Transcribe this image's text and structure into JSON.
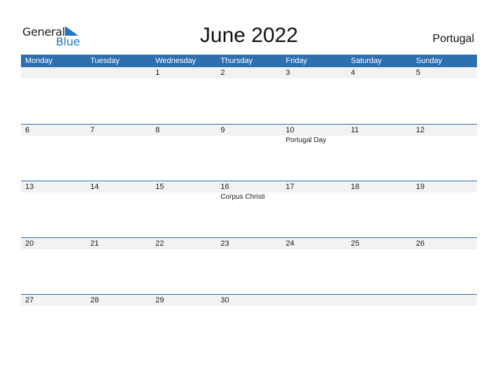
{
  "logo": {
    "word1": "General",
    "word2": "Blue"
  },
  "title": "June 2022",
  "country": "Portugal",
  "colors": {
    "header_bg": "#2e6fb0",
    "date_strip_bg": "#f2f2f2",
    "logo_blue": "#1e78c8"
  },
  "weekdays": [
    "Monday",
    "Tuesday",
    "Wednesday",
    "Thursday",
    "Friday",
    "Saturday",
    "Sunday"
  ],
  "weeks": [
    {
      "days": [
        {
          "num": "",
          "event": ""
        },
        {
          "num": "",
          "event": ""
        },
        {
          "num": "1",
          "event": ""
        },
        {
          "num": "2",
          "event": ""
        },
        {
          "num": "3",
          "event": ""
        },
        {
          "num": "4",
          "event": ""
        },
        {
          "num": "5",
          "event": ""
        }
      ]
    },
    {
      "days": [
        {
          "num": "6",
          "event": ""
        },
        {
          "num": "7",
          "event": ""
        },
        {
          "num": "8",
          "event": ""
        },
        {
          "num": "9",
          "event": ""
        },
        {
          "num": "10",
          "event": "Portugal Day"
        },
        {
          "num": "11",
          "event": ""
        },
        {
          "num": "12",
          "event": ""
        }
      ]
    },
    {
      "days": [
        {
          "num": "13",
          "event": ""
        },
        {
          "num": "14",
          "event": ""
        },
        {
          "num": "15",
          "event": ""
        },
        {
          "num": "16",
          "event": "Corpus Christi"
        },
        {
          "num": "17",
          "event": ""
        },
        {
          "num": "18",
          "event": ""
        },
        {
          "num": "19",
          "event": ""
        }
      ]
    },
    {
      "days": [
        {
          "num": "20",
          "event": ""
        },
        {
          "num": "21",
          "event": ""
        },
        {
          "num": "22",
          "event": ""
        },
        {
          "num": "23",
          "event": ""
        },
        {
          "num": "24",
          "event": ""
        },
        {
          "num": "25",
          "event": ""
        },
        {
          "num": "26",
          "event": ""
        }
      ]
    },
    {
      "days": [
        {
          "num": "27",
          "event": ""
        },
        {
          "num": "28",
          "event": ""
        },
        {
          "num": "29",
          "event": ""
        },
        {
          "num": "30",
          "event": ""
        },
        {
          "num": "",
          "event": ""
        },
        {
          "num": "",
          "event": ""
        },
        {
          "num": "",
          "event": ""
        }
      ]
    }
  ]
}
